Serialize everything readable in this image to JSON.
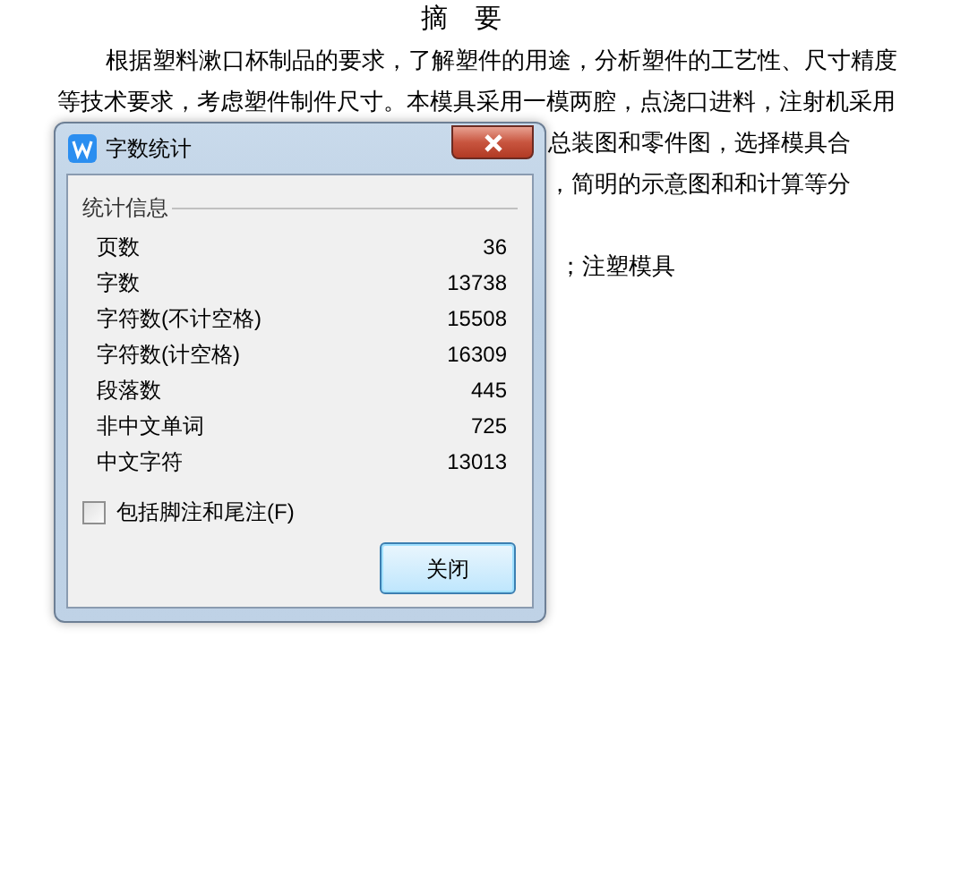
{
  "document": {
    "title": "摘　要",
    "lines": [
      {
        "kind": "indent",
        "text": "根据塑料漱口杯制品的要求，了解塑件的用途，分析塑件的工艺性、尺寸精度"
      },
      {
        "kind": "full",
        "text": "等技术要求，考虑塑件制件尺寸。本模具采用一模两腔，点浇口进料，注射机采用"
      },
      {
        "kind": "right",
        "text": "总装图和零件图，选择模具合"
      },
      {
        "kind": "right",
        "text": "，简明的示意图和和计算等分"
      },
      {
        "kind": "gap"
      },
      {
        "kind": "tail",
        "text": "；注塑模具"
      }
    ]
  },
  "dialog": {
    "title": "字数统计",
    "group": "统计信息",
    "stats": [
      {
        "label": "页数",
        "value": "36"
      },
      {
        "label": "字数",
        "value": "13738"
      },
      {
        "label": "字符数(不计空格)",
        "value": "15508"
      },
      {
        "label": "字符数(计空格)",
        "value": "16309"
      },
      {
        "label": "段落数",
        "value": "445"
      },
      {
        "label": "非中文单词",
        "value": "725"
      },
      {
        "label": "中文字符",
        "value": "13013"
      }
    ],
    "checkbox": {
      "label": "包括脚注和尾注(F)",
      "checked": false
    },
    "button": "关闭"
  }
}
